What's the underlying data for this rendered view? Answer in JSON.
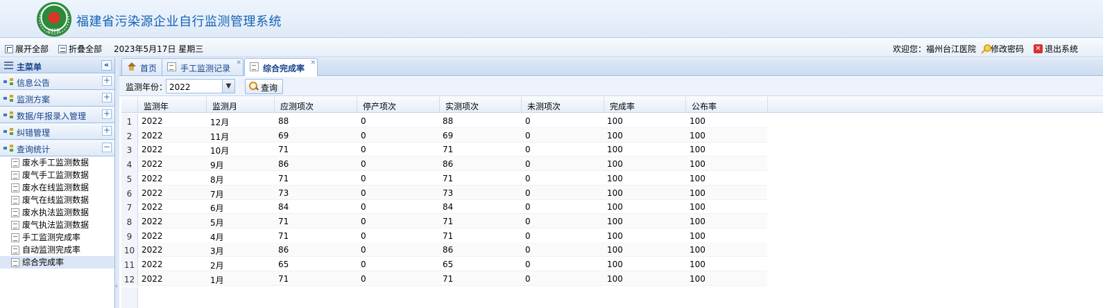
{
  "header": {
    "title": "福建省污染源企业自行监测管理系统",
    "logo_text": "ZHB"
  },
  "toolbar": {
    "expand_all": "展开全部",
    "collapse_all": "折叠全部",
    "date": "2023年5月17日 星期三",
    "welcome": "欢迎您：福州台江医院",
    "change_password": "修改密码",
    "logout": "退出系统"
  },
  "sidebar": {
    "title": "主菜单",
    "collapse_label": "«",
    "sections": [
      {
        "label": "信息公告",
        "toggle": "+"
      },
      {
        "label": "监测方案",
        "toggle": "+"
      },
      {
        "label": "数据/年报录入管理",
        "toggle": "+"
      },
      {
        "label": "纠错管理",
        "toggle": "+"
      },
      {
        "label": "查询统计",
        "toggle": "−"
      }
    ],
    "items": [
      "废水手工监测数据",
      "废气手工监测数据",
      "废水在线监测数据",
      "废气在线监测数据",
      "废水执法监测数据",
      "废气执法监测数据",
      "手工监测完成率",
      "自动监测完成率",
      "综合完成率"
    ]
  },
  "tabs": [
    {
      "label": "首页"
    },
    {
      "label": "手工监测记录"
    },
    {
      "label": "综合完成率"
    }
  ],
  "search": {
    "label": "监测年份：",
    "year": "2022",
    "button": "查询"
  },
  "table": {
    "columns": [
      "监测年",
      "监测月",
      "应测项次",
      "停产项次",
      "实测项次",
      "未测项次",
      "完成率",
      "公布率"
    ],
    "rows": [
      [
        "1",
        "2022",
        "12月",
        "88",
        "0",
        "88",
        "0",
        "100",
        "100"
      ],
      [
        "2",
        "2022",
        "11月",
        "69",
        "0",
        "69",
        "0",
        "100",
        "100"
      ],
      [
        "3",
        "2022",
        "10月",
        "71",
        "0",
        "71",
        "0",
        "100",
        "100"
      ],
      [
        "4",
        "2022",
        "9月",
        "86",
        "0",
        "86",
        "0",
        "100",
        "100"
      ],
      [
        "5",
        "2022",
        "8月",
        "71",
        "0",
        "71",
        "0",
        "100",
        "100"
      ],
      [
        "6",
        "2022",
        "7月",
        "73",
        "0",
        "73",
        "0",
        "100",
        "100"
      ],
      [
        "7",
        "2022",
        "6月",
        "84",
        "0",
        "84",
        "0",
        "100",
        "100"
      ],
      [
        "8",
        "2022",
        "5月",
        "71",
        "0",
        "71",
        "0",
        "100",
        "100"
      ],
      [
        "9",
        "2022",
        "4月",
        "71",
        "0",
        "71",
        "0",
        "100",
        "100"
      ],
      [
        "10",
        "2022",
        "3月",
        "86",
        "0",
        "86",
        "0",
        "100",
        "100"
      ],
      [
        "11",
        "2022",
        "2月",
        "65",
        "0",
        "65",
        "0",
        "100",
        "100"
      ],
      [
        "12",
        "2022",
        "1月",
        "71",
        "0",
        "71",
        "0",
        "100",
        "100"
      ]
    ]
  }
}
